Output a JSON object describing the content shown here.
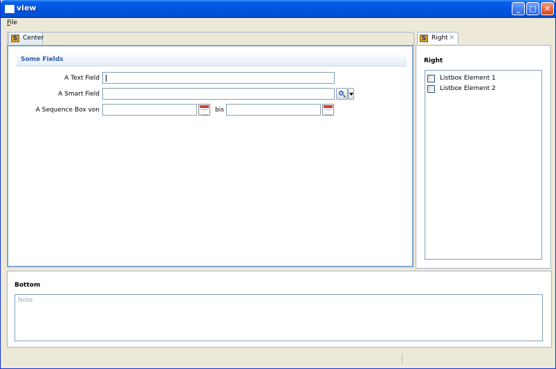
{
  "window": {
    "title": "view",
    "minimize": "_",
    "maximize": "□",
    "close": "✕"
  },
  "menu": {
    "file_underline": "F",
    "file_rest": "ile"
  },
  "tabs": {
    "center": {
      "label": "Center",
      "icon": "S"
    },
    "right": {
      "label": "Right",
      "icon": "S",
      "close": "✕"
    }
  },
  "center": {
    "group_title": "Some Fields",
    "text_field": {
      "label": "A Text Field",
      "value": ""
    },
    "smart_field": {
      "label": "A Smart Field",
      "value": ""
    },
    "sequence_box": {
      "label": "A Sequence Box von",
      "from_value": "",
      "separator": "bis",
      "to_value": ""
    }
  },
  "right": {
    "title": "Right",
    "listbox": [
      {
        "label": "Listbox Element 1",
        "checked": false
      },
      {
        "label": "Listbox Element 2",
        "checked": false
      }
    ]
  },
  "bottom": {
    "title": "Bottom",
    "note_placeholder": "Note",
    "note_value": ""
  },
  "icons": {
    "window": "window-icon",
    "search": "search-icon",
    "dropdown": "chevron-down-icon",
    "calendar": "calendar-icon",
    "s_logo": "s-logo-icon"
  },
  "colors": {
    "titlebar": "#0354e0",
    "group_title": "#2f5ea8",
    "panel_border": "#7da2ce",
    "close_button": "#d8431c"
  }
}
